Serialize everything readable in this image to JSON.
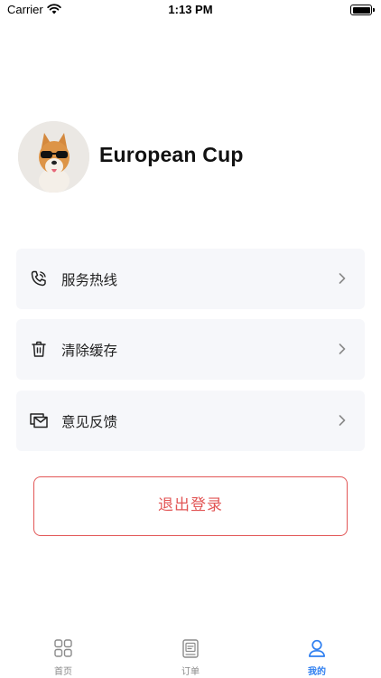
{
  "status_bar": {
    "carrier": "Carrier",
    "time": "1:13 PM",
    "battery_level": 1.0
  },
  "profile": {
    "username": "European Cup",
    "avatar_icon": "shiba-dog-sunglasses-avatar"
  },
  "menu": [
    {
      "label": "服务热线",
      "icon": "phone-icon"
    },
    {
      "label": "清除缓存",
      "icon": "trash-icon"
    },
    {
      "label": "意见反馈",
      "icon": "feedback-mail-icon"
    }
  ],
  "logout_label": "退出登录",
  "tabbar": {
    "tabs": [
      {
        "label": "首页",
        "icon": "grid-icon",
        "active": false
      },
      {
        "label": "订单",
        "icon": "document-icon",
        "active": false
      },
      {
        "label": "我的",
        "icon": "user-icon",
        "active": true
      }
    ]
  },
  "colors": {
    "accent": "#2f7ff0",
    "danger": "#e25656",
    "card_bg": "#f6f7fa",
    "inactive": "#8a8a8a"
  }
}
